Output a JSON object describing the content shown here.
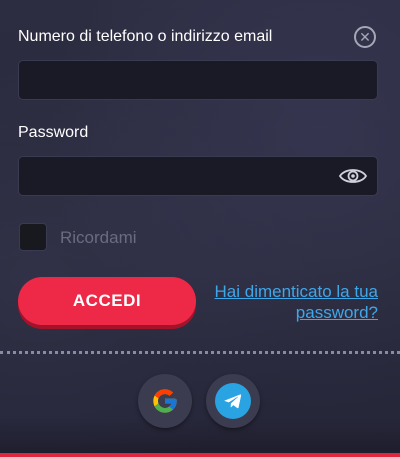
{
  "form": {
    "phone_email_label": "Numero di telefono o indirizzo email",
    "phone_email_value": "",
    "password_label": "Password",
    "password_value": "",
    "remember_label": "Ricordami",
    "login_button": "ACCEDI",
    "forgot_password_link": "Hai dimenticato la tua password?"
  },
  "icons": {
    "close": "close-icon",
    "show_password": "eye-icon",
    "google": "google-icon",
    "telegram": "telegram-icon"
  },
  "colors": {
    "accent": "#ee2947",
    "link": "#3fa7e8",
    "background": "#2a2a3d",
    "input_background": "#1a1a26"
  }
}
